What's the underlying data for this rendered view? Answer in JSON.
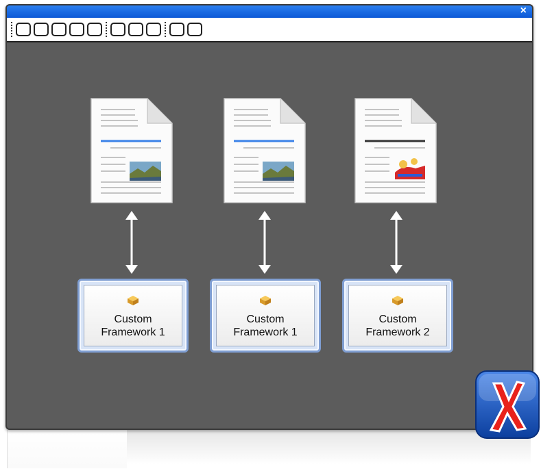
{
  "window": {
    "close_glyph": "×",
    "toolbar_button_groups": [
      5,
      3,
      2
    ],
    "titlebar_color": "#1565e0",
    "canvas_color": "#5c5c5c"
  },
  "diagram": {
    "columns": [
      {
        "document_icon": "document-with-landscape-image-icon",
        "framework": {
          "line1": "Custom",
          "line2": "Framework 1"
        }
      },
      {
        "document_icon": "document-with-landscape-image-icon",
        "framework": {
          "line1": "Custom",
          "line2": "Framework 1"
        }
      },
      {
        "document_icon": "document-with-cartoon-image-icon",
        "framework": {
          "line1": "Custom",
          "line2": "Framework 2"
        }
      }
    ],
    "connector": "bidirectional-arrow",
    "framework_icon": "package-box-icon"
  },
  "branding": {
    "logo_icon": "oxygen-x-logo-icon"
  }
}
